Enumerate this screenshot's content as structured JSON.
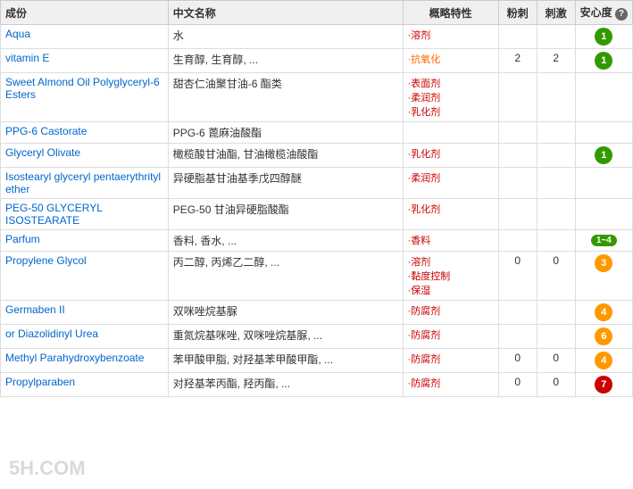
{
  "table": {
    "headers": [
      "成份",
      "中文名称",
      "概略特性",
      "粉刺",
      "刺激",
      "安心度"
    ],
    "rows": [
      {
        "ingredient": "Aqua",
        "chinese": "水",
        "tags": [
          "·溶剂"
        ],
        "tag_colors": [
          "red"
        ],
        "blackheads": "",
        "irritation": "",
        "safety": "1",
        "safety_color": "green"
      },
      {
        "ingredient": "vitamin E",
        "chinese": "生育醇, 生育醇, ...",
        "tags": [
          "·抗氧化"
        ],
        "tag_colors": [
          "orange"
        ],
        "blackheads": "2",
        "irritation": "2",
        "safety": "1",
        "safety_color": "green"
      },
      {
        "ingredient": "Sweet Almond Oil Polyglyceryl-6 Esters",
        "chinese": "甜杏仁油聚甘油-6 酯类",
        "tags": [
          "·表面剂",
          "·柔润剂",
          "·乳化剂"
        ],
        "tag_colors": [
          "red",
          "red",
          "red"
        ],
        "blackheads": "",
        "irritation": "",
        "safety": "",
        "safety_color": ""
      },
      {
        "ingredient": "PPG-6 Castorate",
        "chinese": "PPG-6 蓖麻油酸酯",
        "tags": [],
        "tag_colors": [],
        "blackheads": "",
        "irritation": "",
        "safety": "",
        "safety_color": ""
      },
      {
        "ingredient": "Glyceryl Olivate",
        "chinese": "橄榄酸甘油酯, 甘油橄榄油酸酯",
        "tags": [
          "·乳化剂"
        ],
        "tag_colors": [
          "red"
        ],
        "blackheads": "",
        "irritation": "",
        "safety": "1",
        "safety_color": "green"
      },
      {
        "ingredient": "Isostearyl glyceryl pentaerythrityl ether",
        "chinese": "异硬脂基甘油基季戊四醇醚",
        "tags": [
          "·柔润剂"
        ],
        "tag_colors": [
          "red"
        ],
        "blackheads": "",
        "irritation": "",
        "safety": "",
        "safety_color": ""
      },
      {
        "ingredient": "PEG-50 GLYCERYL ISOSTEARATE",
        "chinese": "PEG-50 甘油异硬脂酸酯",
        "tags": [
          "·乳化剂"
        ],
        "tag_colors": [
          "red"
        ],
        "blackheads": "",
        "irritation": "",
        "safety": "",
        "safety_color": ""
      },
      {
        "ingredient": "Parfum",
        "chinese": "香料, 香水, ...",
        "tags": [
          "·香料"
        ],
        "tag_colors": [
          "red"
        ],
        "blackheads": "",
        "irritation": "",
        "safety": "1~4",
        "safety_color": "green-range"
      },
      {
        "ingredient": "Propylene Glycol",
        "chinese": "丙二醇, 丙烯乙二醇, ...",
        "tags": [
          "·溶剂",
          "·黏度控制",
          "·保湿"
        ],
        "tag_colors": [
          "red",
          "red",
          "red"
        ],
        "blackheads": "0",
        "irritation": "0",
        "safety": "3",
        "safety_color": "orange"
      },
      {
        "ingredient": "Germaben II",
        "chinese": "双咪唑烷基脲",
        "tags": [
          "·防腐剂"
        ],
        "tag_colors": [
          "red"
        ],
        "blackheads": "",
        "irritation": "",
        "safety": "4",
        "safety_color": "orange"
      },
      {
        "ingredient": "or Diazolidinyl Urea",
        "chinese": "重氮烷基咪唑, 双咪唑烷基脲, ...",
        "tags": [
          "·防腐剂"
        ],
        "tag_colors": [
          "red"
        ],
        "blackheads": "",
        "irritation": "",
        "safety": "6",
        "safety_color": "orange"
      },
      {
        "ingredient": "Methyl Parahydroxybenzoate",
        "chinese": "苯甲酸甲脂, 对羟基苯甲酸甲酯, ...",
        "tags": [
          "·防腐剂"
        ],
        "tag_colors": [
          "red"
        ],
        "blackheads": "0",
        "irritation": "0",
        "safety": "4",
        "safety_color": "orange"
      },
      {
        "ingredient": "Propylparaben",
        "chinese": "对羟基苯丙酯, 羟丙酯, ...",
        "tags": [
          "·防腐剂"
        ],
        "tag_colors": [
          "red"
        ],
        "blackheads": "0",
        "irritation": "0",
        "safety": "7",
        "safety_color": "red"
      }
    ]
  },
  "watermark": "5H.COM"
}
